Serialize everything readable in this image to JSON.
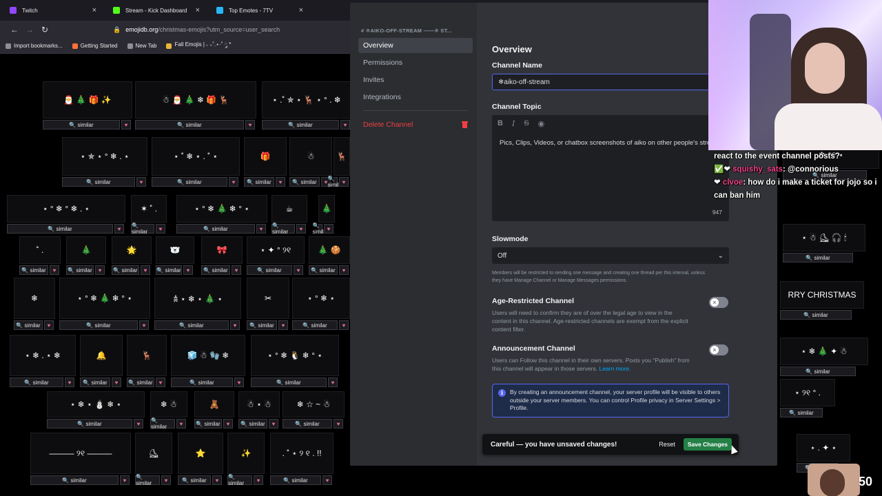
{
  "browser": {
    "tabs": [
      {
        "label": "Twitch",
        "color": "#9146ff"
      },
      {
        "label": "Stream - Kick Dashboard",
        "color": "#53fc18"
      },
      {
        "label": "Top Emotes - 7TV",
        "color": "#29b6f6"
      }
    ],
    "url": {
      "host": "emojidb.org",
      "path": "/christmas-emojis?utm_source=user_search"
    },
    "bookmarks": [
      "Import bookmarks...",
      "Getting Started",
      "New Tab",
      "Fall Emojis | ˖ ₊˚.⋆·˚ ༘ *"
    ]
  },
  "emoji_page": {
    "similar_label": "similar",
    "cards": [
      "🎅 🎄 🎁 ✨",
      "☃ 🎅 🎄 ❄ 🎁 🦌",
      "⋆ .˚ ✯ ⋆ 🦌 ⋆ ° . ❄",
      "⋆ ✯ ⋆ ° ❄ . ⋆",
      "⋆ ˚ ❄ ⋆ . ˚ ⋆",
      "🎁",
      "☃",
      "🦌",
      "⋆ ° ❄ ° ❄ . ⋆",
      "✶ ˚ .",
      "⋆ ° ❄ 🎄 ❄ ° ⋆",
      "☕",
      "🎄",
      "˚ .",
      "🎄",
      "🌟",
      "🐻‍❄️",
      "🎀",
      "⋆ ✦ ° ୨୧",
      "🎄 🍪",
      "❄",
      "⋆ ° ❄ 🎄 ❄ ° ⋆",
      "𖠋 ⋆ ❄ ⋆ 🎄 ⋆",
      "✂",
      "⋆ ° ❄ ⋆",
      "⋆ ❄ . ⋆ ❄",
      "🔔",
      "🦌",
      "🧊 ☃ 🧤 ❄",
      "⋆ ° ❄ 🐧 ❄ ° ⋆",
      "⋆ ❄ ⋆ ⛄ ❄ ⋆",
      "❄ ☃",
      "🧸",
      "☃ ⋆ ☃",
      "❄ ☆ ~ ☃",
      "——— ୨୧ ———",
      "⛸",
      "⭐",
      "✨",
      ". ˚ ⋆ ୨ ୧ . !!",
      "❄ ୨୧ ⋆",
      "⋆ ☃ ⛸ 🎧 🕯",
      "RRY CHRISTMAS",
      "⋆ ❄ 🎄 ✦ ☃",
      "⋆ ୨୧ ° .",
      "⋆ . ✦ ⋆"
    ]
  },
  "discord": {
    "sidebar": {
      "channel_header": "# ❄AIKO-OFF-STREAM ——❄ ST...",
      "items": [
        "Overview",
        "Permissions",
        "Invites",
        "Integrations"
      ],
      "delete_label": "Delete Channel"
    },
    "main": {
      "heading": "Overview",
      "channel_name_label": "Channel Name",
      "channel_name_value": "❄aiko-off-stream",
      "topic_label": "Channel Topic",
      "topic_text": "Pics, Clips, Videos, or chatbox screenshots of aiko on other people's streams",
      "topic_count": "947",
      "slowmode_label": "Slowmode",
      "slowmode_value": "Off",
      "slowmode_help": "Members will be restricted to sending one message and creating one thread per this interval, unless they have Manage Channel or Manage Messages permissions.",
      "age_title": "Age-Restricted Channel",
      "age_desc": "Users will need to confirm they are of over the legal age to view in the content in this channel. Age-restricted channels are exempt from the explicit content filter.",
      "announce_title": "Announcement Channel",
      "announce_desc": "Users can Follow this channel in their own servers. Posts you \"Publish\" from this channel will appear in those servers.",
      "learn_more": "Learn more.",
      "info_text": "By creating an announcement channel, your server profile will be visible to others outside your server members. You can control Profile privacy in Server Settings > Profile."
    },
    "unsaved": {
      "text": "Careful — you have unsaved changes!",
      "reset": "Reset",
      "save": "Save Changes"
    }
  },
  "stream": {
    "chat": [
      {
        "user": "",
        "text": "react to the event channel posts?"
      },
      {
        "user": "squishy_sats",
        "text": ": @connorious"
      },
      {
        "user": "clvoe",
        "text": ": how do i make a ticket for jojo so i can ban him"
      }
    ],
    "viewer_count": "50"
  },
  "colors": {
    "discord_bg": "#313338",
    "discord_sidebar": "#2b2d31",
    "blurple": "#5865f2",
    "danger": "#f23f43",
    "save_green": "#248046"
  }
}
